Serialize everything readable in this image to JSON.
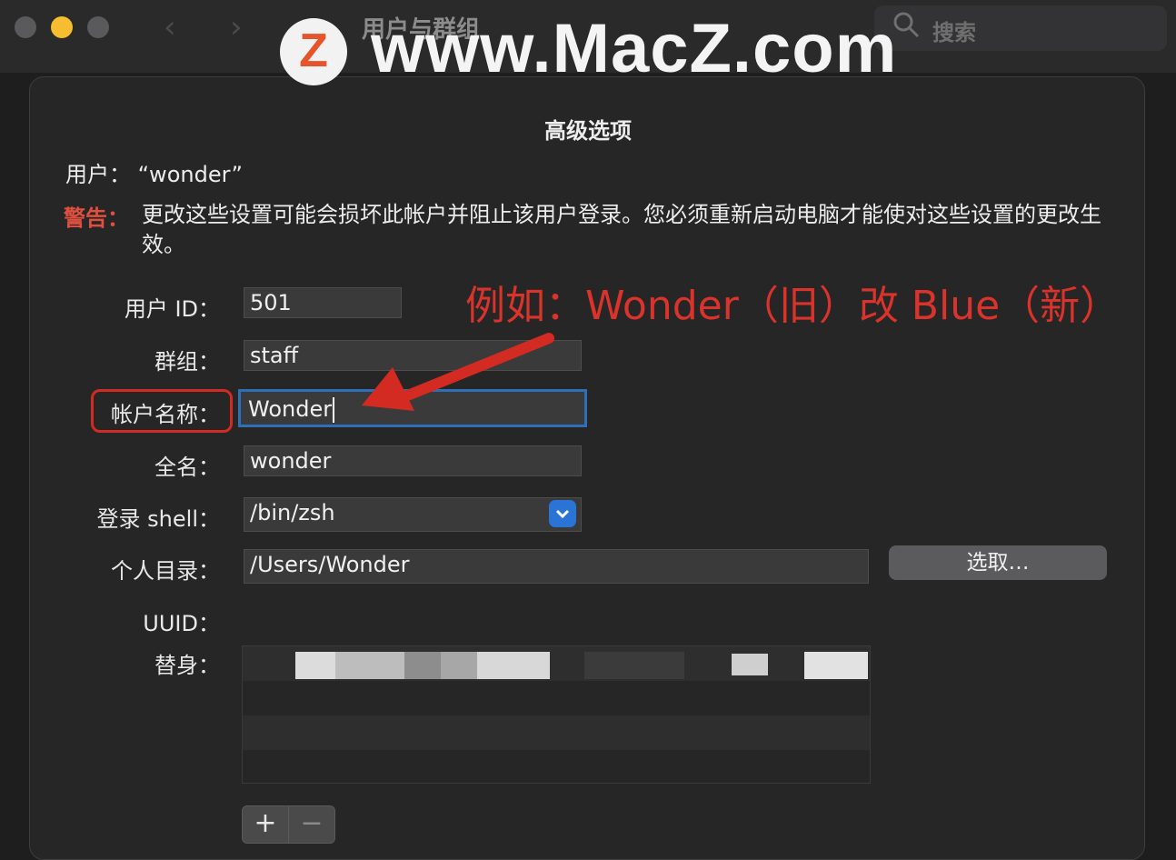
{
  "window": {
    "title": "用户与群组",
    "search_placeholder": "搜索",
    "back_glyph": "‹",
    "forward_glyph": "›"
  },
  "watermark": {
    "text": "www.MacZ.com",
    "logo_letter": "Z"
  },
  "sheet": {
    "title": "高级选项",
    "user_line": "用户：  “wonder”",
    "warning_label": "警告：",
    "warning_text": "更改这些设置可能会损坏此帐户并阻止该用户登录。您必须重新启动电脑才能使对这些设置的更改生效。",
    "fields": {
      "user_id_label": "用户 ID：",
      "user_id_value": "501",
      "group_label": "群组：",
      "group_value": "staff",
      "account_name_label": "帐户名称：",
      "account_name_value": "Wonder",
      "full_name_label": "全名：",
      "full_name_value": "wonder",
      "login_shell_label": "登录 shell：",
      "login_shell_value": "/bin/zsh",
      "home_dir_label": "个人目录：",
      "home_dir_value": "/Users/Wonder",
      "choose_button": "选取…",
      "uuid_label": "UUID：",
      "alias_label": "替身："
    },
    "plus_label": "+",
    "minus_label": "−"
  },
  "annotation": {
    "text": "例如：Wonder（旧）改 Blue（新）",
    "color": "#d9332b"
  },
  "colors": {
    "accent_blue": "#2a74d6",
    "focus_ring": "#2f6fb8",
    "warning_red": "#e0503f",
    "traffic_yellow": "#f5bd2f"
  }
}
